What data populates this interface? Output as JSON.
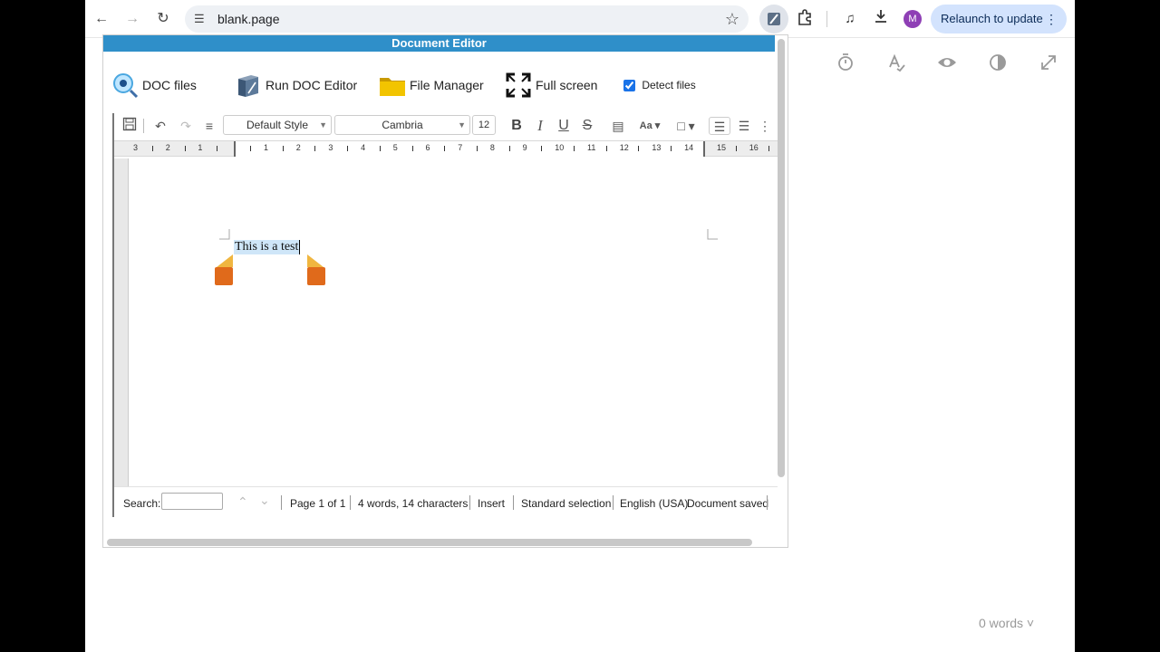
{
  "browser": {
    "url": "blank.page",
    "relaunch_label": "Relaunch to update",
    "avatar_letter": "M"
  },
  "page": {
    "word_count": "0 words"
  },
  "popup": {
    "title": "Document Editor",
    "links": [
      {
        "label": "DOC files",
        "icon": "magnifier-icon"
      },
      {
        "label": "Run DOC Editor",
        "icon": "book-icon"
      },
      {
        "label": "File Manager",
        "icon": "folder-icon"
      },
      {
        "label": "Full screen",
        "icon": "fullscreen-icon"
      }
    ],
    "detect_label": "Detect files",
    "detect_checked": true
  },
  "editor": {
    "paragraph_style": "Default Style",
    "font": "Cambria",
    "font_size": "12",
    "ruler_left": [
      "3",
      "2",
      "1"
    ],
    "ruler_main": [
      "1",
      "2",
      "3",
      "4",
      "5",
      "6",
      "7",
      "8",
      "9",
      "10",
      "11",
      "12",
      "13",
      "14"
    ],
    "ruler_right": [
      "15",
      "16"
    ],
    "text": "This is a test",
    "status": {
      "search_label": "Search:",
      "page": "Page 1 of 1",
      "counts": "4 words, 14 characters",
      "mode": "Insert",
      "selection": "Standard selection",
      "language": "English (USA)",
      "saved": "Document saved"
    }
  },
  "colors": {
    "title_bar": "#2f8fc9",
    "relaunch_bg": "#d3e3fd",
    "avatar": "#8e3fb5",
    "selection": "#cfe6f8",
    "handle": "#e06a1b"
  }
}
